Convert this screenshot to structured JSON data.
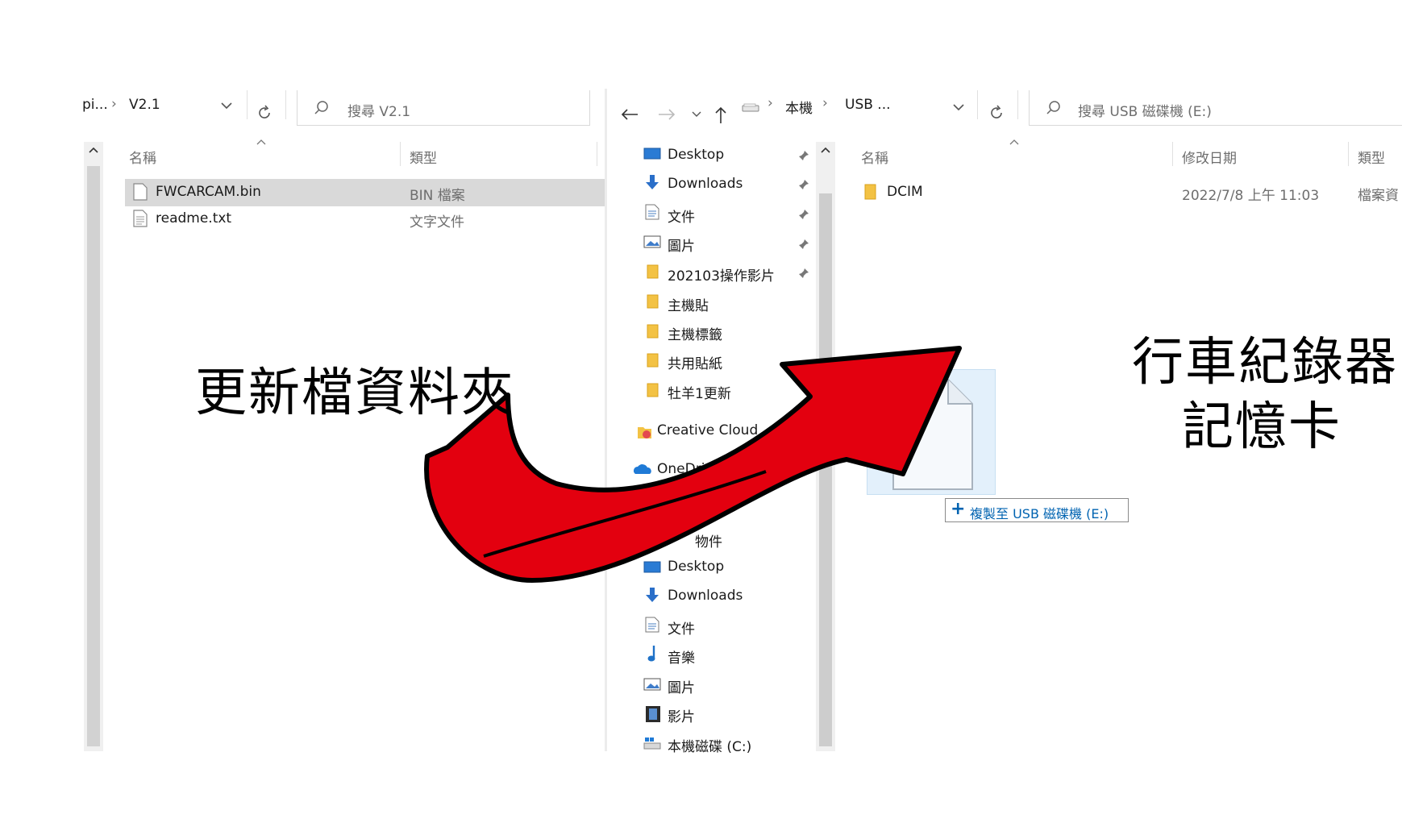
{
  "left": {
    "breadcrumb": [
      "pi...",
      "V2.1"
    ],
    "search_placeholder": "搜尋 V2.1",
    "columns": [
      "名稱",
      "類型"
    ],
    "files": [
      {
        "name": "FWCARCAM.bin",
        "type": "BIN 檔案",
        "selected": true
      },
      {
        "name": "readme.txt",
        "type": "文字文件",
        "selected": false
      }
    ]
  },
  "right": {
    "breadcrumb": [
      "本機",
      "USB ..."
    ],
    "search_placeholder": "搜尋 USB 磁碟機 (E:)",
    "columns": [
      "名稱",
      "修改日期",
      "類型"
    ],
    "files": [
      {
        "name": "DCIM",
        "date": "2022/7/8 上午 11:03",
        "type": "檔案資"
      }
    ]
  },
  "nav": {
    "quick_access": [
      {
        "label": "Desktop",
        "icon": "desktop-icon",
        "pinned": true
      },
      {
        "label": "Downloads",
        "icon": "download-icon",
        "pinned": true
      },
      {
        "label": "文件",
        "icon": "document-icon",
        "pinned": true
      },
      {
        "label": "圖片",
        "icon": "picture-icon",
        "pinned": true
      },
      {
        "label": "202103操作影片",
        "icon": "folder-icon",
        "pinned": true
      },
      {
        "label": "主機貼",
        "icon": "folder-icon",
        "pinned": false
      },
      {
        "label": "主機標籤",
        "icon": "folder-icon",
        "pinned": false
      },
      {
        "label": "共用貼紙",
        "icon": "folder-icon",
        "pinned": false
      },
      {
        "label": "牡羊1更新",
        "icon": "folder-icon",
        "pinned": false
      }
    ],
    "creative_cloud": "Creative Cloud",
    "onedrive": "OneDri",
    "objects_partial": "物件",
    "this_pc": [
      {
        "label": "Desktop",
        "icon": "desktop-icon"
      },
      {
        "label": "Downloads",
        "icon": "download-icon"
      },
      {
        "label": "文件",
        "icon": "document-icon"
      },
      {
        "label": "音樂",
        "icon": "music-icon"
      },
      {
        "label": "圖片",
        "icon": "picture-icon"
      },
      {
        "label": "影片",
        "icon": "video-icon"
      },
      {
        "label": "本機磁碟 (C:)",
        "icon": "drive-icon"
      }
    ]
  },
  "drag": {
    "tooltip_plus": "+",
    "tooltip_text": "複製至 USB 磁碟機 (E:)"
  },
  "annotations": {
    "left_label": "更新檔資料夾",
    "right_line1": "行車紀錄器",
    "right_line2": "記憶卡"
  },
  "colors": {
    "arrow_fill": "#e3000f",
    "selection": "#d9d9d9",
    "accent_blue": "#0063b1",
    "folder_yellow": "#f3c244"
  }
}
